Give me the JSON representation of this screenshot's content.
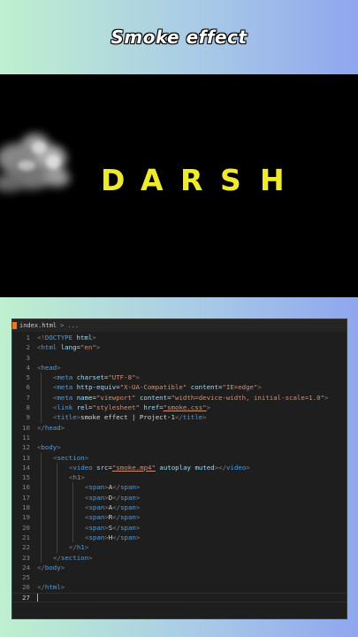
{
  "header": {
    "title": "Smoke effect"
  },
  "preview": {
    "letters": [
      "D",
      "A",
      "R",
      "S",
      "H"
    ]
  },
  "editor": {
    "tab_label": "index.html",
    "breadcrumb_sep": ">",
    "breadcrumb_more": "...",
    "lines": [
      {
        "n": "1",
        "indent": 0,
        "tokens": [
          [
            "p",
            "<!"
          ],
          [
            "doc",
            "DOCTYPE"
          ],
          [
            "txt",
            " "
          ],
          [
            "attr",
            "html"
          ],
          [
            "p",
            ">"
          ]
        ]
      },
      {
        "n": "2",
        "indent": 0,
        "tokens": [
          [
            "p",
            "<"
          ],
          [
            "tag",
            "html"
          ],
          [
            "txt",
            " "
          ],
          [
            "attr",
            "lang"
          ],
          [
            "txt",
            "="
          ],
          [
            "str",
            "\"en\""
          ],
          [
            "p",
            ">"
          ]
        ]
      },
      {
        "n": "3",
        "indent": 0,
        "tokens": []
      },
      {
        "n": "4",
        "indent": 0,
        "tokens": [
          [
            "p",
            "<"
          ],
          [
            "tag",
            "head"
          ],
          [
            "p",
            ">"
          ]
        ]
      },
      {
        "n": "5",
        "indent": 1,
        "tokens": [
          [
            "p",
            "<"
          ],
          [
            "tag",
            "meta"
          ],
          [
            "txt",
            " "
          ],
          [
            "attr",
            "charset"
          ],
          [
            "txt",
            "="
          ],
          [
            "str",
            "\"UTF-8\""
          ],
          [
            "p",
            ">"
          ]
        ]
      },
      {
        "n": "6",
        "indent": 1,
        "tokens": [
          [
            "p",
            "<"
          ],
          [
            "tag",
            "meta"
          ],
          [
            "txt",
            " "
          ],
          [
            "attr",
            "http-equiv"
          ],
          [
            "txt",
            "="
          ],
          [
            "str",
            "\"X-UA-Compatible\""
          ],
          [
            "txt",
            " "
          ],
          [
            "attr",
            "content"
          ],
          [
            "txt",
            "="
          ],
          [
            "str",
            "\"IE=edge\""
          ],
          [
            "p",
            ">"
          ]
        ]
      },
      {
        "n": "7",
        "indent": 1,
        "tokens": [
          [
            "p",
            "<"
          ],
          [
            "tag",
            "meta"
          ],
          [
            "txt",
            " "
          ],
          [
            "attr",
            "name"
          ],
          [
            "txt",
            "="
          ],
          [
            "str",
            "\"viewport\""
          ],
          [
            "txt",
            " "
          ],
          [
            "attr",
            "content"
          ],
          [
            "txt",
            "="
          ],
          [
            "str",
            "\"width=device-width, initial-scale=1.0\""
          ],
          [
            "p",
            ">"
          ]
        ]
      },
      {
        "n": "8",
        "indent": 1,
        "tokens": [
          [
            "p",
            "<"
          ],
          [
            "tag",
            "link"
          ],
          [
            "txt",
            " "
          ],
          [
            "attr",
            "rel"
          ],
          [
            "txt",
            "="
          ],
          [
            "str",
            "\"stylesheet\""
          ],
          [
            "txt",
            " "
          ],
          [
            "attr",
            "href"
          ],
          [
            "txt",
            "="
          ],
          [
            "stru",
            "\"smoke.css\""
          ],
          [
            "p",
            ">"
          ]
        ]
      },
      {
        "n": "9",
        "indent": 1,
        "tokens": [
          [
            "p",
            "<"
          ],
          [
            "tag",
            "title"
          ],
          [
            "p",
            ">"
          ],
          [
            "txt",
            "smoke effect | Project-1"
          ],
          [
            "p",
            "</"
          ],
          [
            "tag",
            "title"
          ],
          [
            "p",
            ">"
          ]
        ]
      },
      {
        "n": "10",
        "indent": 0,
        "tokens": [
          [
            "p",
            "</"
          ],
          [
            "tag",
            "head"
          ],
          [
            "p",
            ">"
          ]
        ]
      },
      {
        "n": "11",
        "indent": 0,
        "tokens": []
      },
      {
        "n": "12",
        "indent": 0,
        "tokens": [
          [
            "p",
            "<"
          ],
          [
            "tag",
            "body"
          ],
          [
            "p",
            ">"
          ]
        ]
      },
      {
        "n": "13",
        "indent": 1,
        "tokens": [
          [
            "p",
            "<"
          ],
          [
            "tag",
            "section"
          ],
          [
            "p",
            ">"
          ]
        ]
      },
      {
        "n": "14",
        "indent": 2,
        "tokens": [
          [
            "p",
            "<"
          ],
          [
            "tag",
            "video"
          ],
          [
            "txt",
            " "
          ],
          [
            "attr",
            "src"
          ],
          [
            "txt",
            "="
          ],
          [
            "stru",
            "\"smoke.mp4\""
          ],
          [
            "txt",
            " "
          ],
          [
            "attr",
            "autoplay"
          ],
          [
            "txt",
            " "
          ],
          [
            "attr",
            "muted"
          ],
          [
            "p",
            "></"
          ],
          [
            "tag",
            "video"
          ],
          [
            "p",
            ">"
          ]
        ]
      },
      {
        "n": "15",
        "indent": 2,
        "tokens": [
          [
            "p",
            "<"
          ],
          [
            "tag",
            "h1"
          ],
          [
            "p",
            ">"
          ]
        ]
      },
      {
        "n": "16",
        "indent": 3,
        "tokens": [
          [
            "p",
            "<"
          ],
          [
            "tag",
            "span"
          ],
          [
            "p",
            ">"
          ],
          [
            "txt",
            "A"
          ],
          [
            "p",
            "</"
          ],
          [
            "tag",
            "span"
          ],
          [
            "p",
            ">"
          ]
        ]
      },
      {
        "n": "17",
        "indent": 3,
        "tokens": [
          [
            "p",
            "<"
          ],
          [
            "tag",
            "span"
          ],
          [
            "p",
            ">"
          ],
          [
            "txt",
            "D"
          ],
          [
            "p",
            "</"
          ],
          [
            "tag",
            "span"
          ],
          [
            "p",
            ">"
          ]
        ]
      },
      {
        "n": "18",
        "indent": 3,
        "tokens": [
          [
            "p",
            "<"
          ],
          [
            "tag",
            "span"
          ],
          [
            "p",
            ">"
          ],
          [
            "txt",
            "A"
          ],
          [
            "p",
            "</"
          ],
          [
            "tag",
            "span"
          ],
          [
            "p",
            ">"
          ]
        ]
      },
      {
        "n": "19",
        "indent": 3,
        "tokens": [
          [
            "p",
            "<"
          ],
          [
            "tag",
            "span"
          ],
          [
            "p",
            ">"
          ],
          [
            "txt",
            "R"
          ],
          [
            "p",
            "</"
          ],
          [
            "tag",
            "span"
          ],
          [
            "p",
            ">"
          ]
        ]
      },
      {
        "n": "20",
        "indent": 3,
        "tokens": [
          [
            "p",
            "<"
          ],
          [
            "tag",
            "span"
          ],
          [
            "p",
            ">"
          ],
          [
            "txt",
            "S"
          ],
          [
            "p",
            "</"
          ],
          [
            "tag",
            "span"
          ],
          [
            "p",
            ">"
          ]
        ]
      },
      {
        "n": "21",
        "indent": 3,
        "tokens": [
          [
            "p",
            "<"
          ],
          [
            "tag",
            "span"
          ],
          [
            "p",
            ">"
          ],
          [
            "txt",
            "H"
          ],
          [
            "p",
            "</"
          ],
          [
            "tag",
            "span"
          ],
          [
            "p",
            ">"
          ]
        ]
      },
      {
        "n": "22",
        "indent": 2,
        "tokens": [
          [
            "p",
            "</"
          ],
          [
            "tag",
            "h1"
          ],
          [
            "p",
            ">"
          ]
        ]
      },
      {
        "n": "23",
        "indent": 1,
        "tokens": [
          [
            "p",
            "</"
          ],
          [
            "tag",
            "section"
          ],
          [
            "p",
            ">"
          ]
        ]
      },
      {
        "n": "24",
        "indent": 0,
        "tokens": [
          [
            "p",
            "</"
          ],
          [
            "tag",
            "body"
          ],
          [
            "p",
            ">"
          ]
        ]
      },
      {
        "n": "25",
        "indent": 0,
        "tokens": []
      },
      {
        "n": "26",
        "indent": 0,
        "tokens": [
          [
            "p",
            "</"
          ],
          [
            "tag",
            "html"
          ],
          [
            "p",
            ">"
          ]
        ]
      },
      {
        "n": "27",
        "indent": 0,
        "tokens": [],
        "cursor": true
      }
    ]
  },
  "colors": {
    "letters": "#f0ea2c",
    "editor_bg": "#1e1e1e",
    "tag": "#569cd6",
    "attr": "#9cdcfe",
    "string": "#ce9178",
    "punct": "#808080"
  }
}
